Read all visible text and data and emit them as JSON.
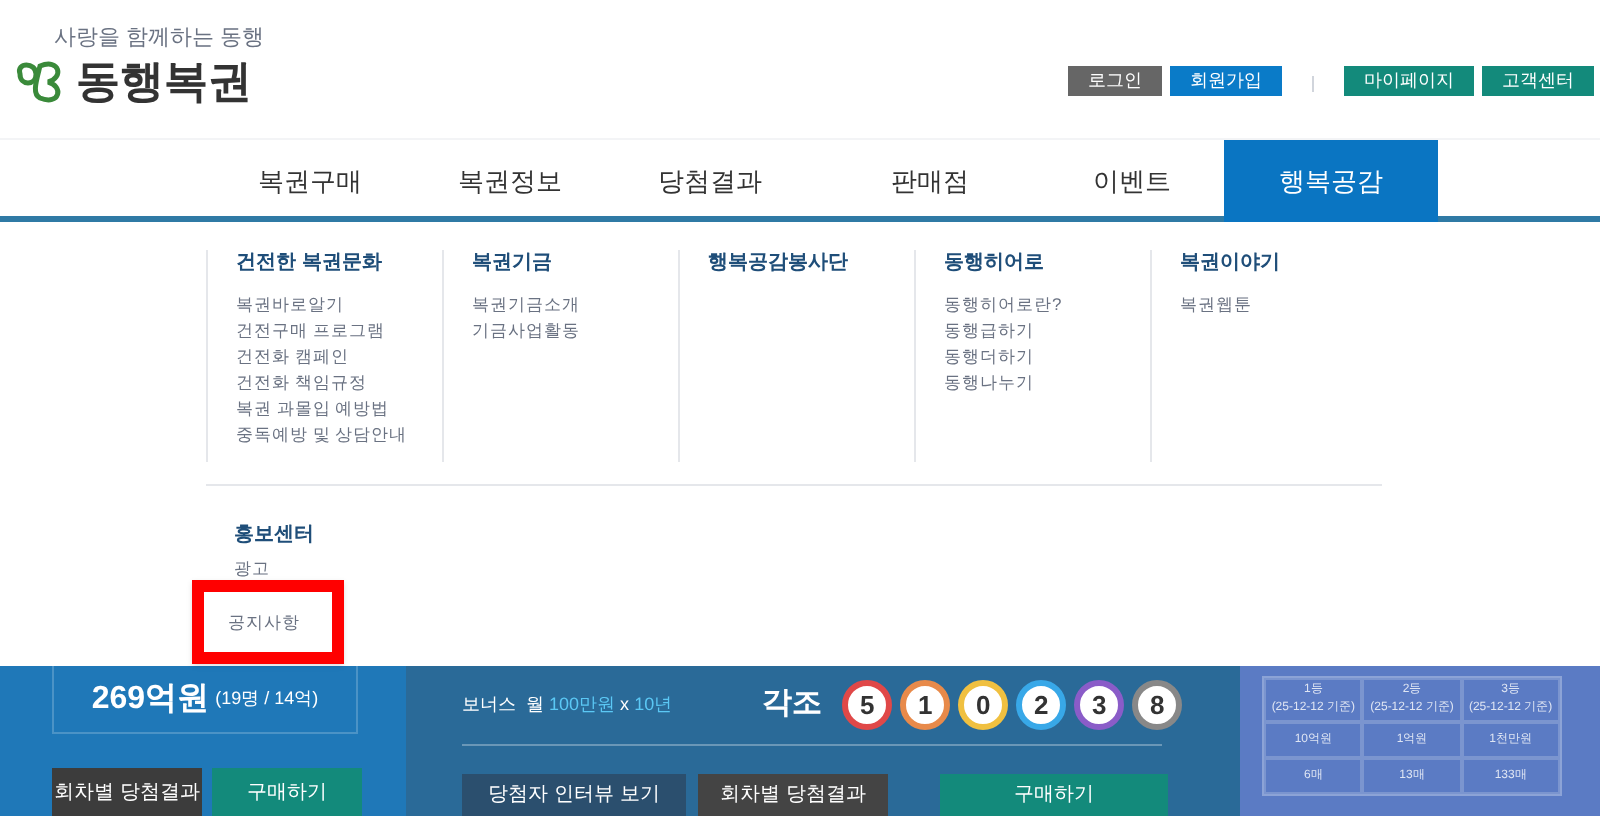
{
  "header": {
    "tagline": "사랑을 함께하는 동행",
    "title": "동행복권",
    "buttons": [
      {
        "label": "로그인",
        "color": "#666666"
      },
      {
        "label": "회원가입",
        "color": "#0a7bc8"
      },
      {
        "label": "마이페이지",
        "color": "#138a7b"
      },
      {
        "label": "고객센터",
        "color": "#138a7b"
      }
    ]
  },
  "nav": [
    {
      "label": "복권구매",
      "selected": false
    },
    {
      "label": "복권정보",
      "selected": false
    },
    {
      "label": "당첨결과",
      "selected": false
    },
    {
      "label": "판매점",
      "selected": false
    },
    {
      "label": "이벤트",
      "selected": false
    },
    {
      "label": "행복공감",
      "selected": true
    }
  ],
  "menu": {
    "columns": [
      {
        "title": "건전한 복권문화",
        "items": [
          "복권바로알기",
          "건전구매 프로그램",
          "건전화 캠페인",
          "건전화 책임규정",
          "복권 과몰입 예방법",
          "중독예방 및 상담안내"
        ]
      },
      {
        "title": "복권기금",
        "items": [
          "복권기금소개",
          "기금사업활동"
        ]
      },
      {
        "title": "행복공감봉사단"
      },
      {
        "title": "동행히어로",
        "items": [
          "동행히어로란?",
          "동행급하기",
          "동행더하기",
          "동행나누기"
        ]
      },
      {
        "title": "복권이야기",
        "items": [
          "복권웹툰"
        ]
      }
    ],
    "section": {
      "title": "홍보센터",
      "items": [
        {
          "label": "광고",
          "highlighted": false
        },
        {
          "label": "공지사항",
          "highlighted": true
        }
      ]
    }
  },
  "jackpot": {
    "amount": "269억원",
    "detail": "(19명 / 14억)",
    "buttons": [
      "회차별 당첨결과",
      "구매하기"
    ]
  },
  "pension": {
    "bonus_label": "보너스",
    "monthly": "월",
    "amount": "100만원",
    "times": "x",
    "years": "10년",
    "group_label": "각조",
    "balls": [
      {
        "number": "5",
        "color": "#e04848"
      },
      {
        "number": "1",
        "color": "#e88a4a"
      },
      {
        "number": "0",
        "color": "#f0c040"
      },
      {
        "number": "2",
        "color": "#38a8e8"
      },
      {
        "number": "3",
        "color": "#8a5cc8"
      },
      {
        "number": "8",
        "color": "#888888"
      }
    ],
    "buttons": [
      "당첨자 인터뷰 보기",
      "회차별 당첨결과",
      "구매하기"
    ]
  },
  "stock": {
    "rows": [
      [
        "1등\n(25-12-12 기준)",
        "2등\n(25-12-12 기준)",
        "3등\n(25-12-12 기준)"
      ],
      [
        "10억원",
        "1억원",
        "1천만원"
      ],
      [
        "6매",
        "13매",
        "133매"
      ]
    ]
  }
}
